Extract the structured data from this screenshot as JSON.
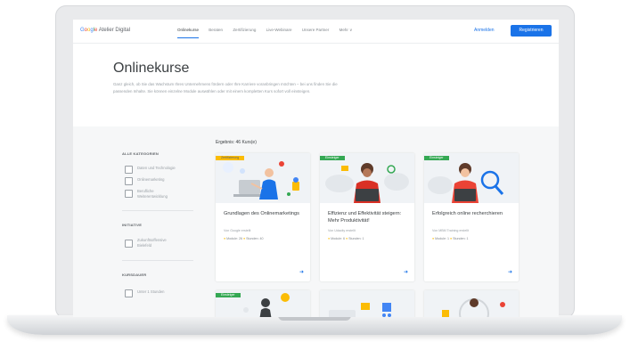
{
  "header": {
    "logo": {
      "brand_letters": [
        "G",
        "o",
        "o",
        "g",
        "l",
        "e"
      ],
      "suffix": "Atelier Digital"
    },
    "nav": [
      "Onlinekurse",
      "Beraten",
      "Zertifizierung",
      "Live-Webinare",
      "Unsere Partner",
      "Mehr ∨"
    ],
    "active_nav": "Onlinekurse",
    "login": "Anmelden",
    "register": "Registrieren"
  },
  "hero": {
    "title": "Onlinekurse",
    "text": "Ganz gleich, ob Sie das Wachstum Ihres Unternehmens fördern oder Ihre Karriere voranbringen möchten – bei uns finden Sie die passenden Inhalte. Sie können einzelne Module auswählen oder mit einem kompletten Kurs sofort voll einsteigen."
  },
  "filters": [
    {
      "heading": "ALLE KATEGORIEN",
      "options": [
        "Daten und Technologie",
        "Onlinemarketing",
        "Berufliche Weiterentwicklung"
      ]
    },
    {
      "heading": "INITIATIVE",
      "options": [
        "Zukunftsoffensive Bielefeld"
      ]
    },
    {
      "heading": "KURSDAUER",
      "options": [
        "Unter 1 Stunden"
      ]
    }
  ],
  "results": "Ergebnis: 46 Kurs(e)",
  "cards": [
    {
      "tag": "Zertifizierung",
      "tag_color": "yellow",
      "title": "Grundlagen des Onlinemarketings",
      "provider": "Von Google erstellt",
      "modules": "Module: 26",
      "hours": "Stunden: 40"
    },
    {
      "tag": "Einsteiger",
      "tag_color": "green",
      "title": "Effizienz und Effektivität steigern: Mehr Produktivität!",
      "provider": "Von Udacity erstellt",
      "modules": "Module: 6",
      "hours": "Stunden: 1"
    },
    {
      "tag": "Einsteiger",
      "tag_color": "green",
      "title": "Erfolgreich online recherchieren",
      "provider": "Von MBM Training erstellt",
      "modules": "Module: 1",
      "hours": "Stunden: 1"
    },
    {
      "tag": "Einsteiger",
      "tag_color": "green",
      "title": "",
      "provider": "",
      "modules": "",
      "hours": ""
    },
    {
      "tag": "",
      "tag_color": "",
      "title": "",
      "provider": "",
      "modules": "",
      "hours": ""
    },
    {
      "tag": "",
      "tag_color": "",
      "title": "",
      "provider": "",
      "modules": "",
      "hours": ""
    }
  ],
  "colors": {
    "accent": "#1a73e8",
    "tag_green": "#34a853",
    "tag_yellow": "#fbbc05"
  }
}
